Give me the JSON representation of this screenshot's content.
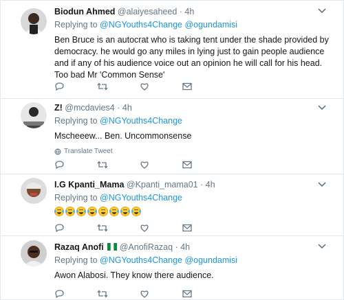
{
  "replying_prefix": "Replying to",
  "translate_label": "Translate Tweet",
  "colors": {
    "link": "#1b95e0",
    "muted": "#657786",
    "text": "#14171a",
    "border": "#e1e8ed"
  },
  "tweets": [
    {
      "name": "Biodun Ahmed",
      "handle": "@alaiyesaheed",
      "dot": "·",
      "time": "4h",
      "mentions": [
        "@NGYouths4Change",
        "@ogundamisi"
      ],
      "text": "Ben Bruce is an autocrat who is taking tent under the shade provided by democracy. he would go any miles in lying just to gain people audience and if any of his audience voice out an opinion he will call for his head. Too bad Mr 'Common Sense'",
      "icons": [
        "reply-icon",
        "retweet-icon",
        "like-icon",
        "message-icon"
      ]
    },
    {
      "name": "Z!",
      "handle": "@mcdavies4",
      "dot": "·",
      "time": "4h",
      "mentions": [
        "@NGYouths4Change"
      ],
      "text": "Mscheeew... Ben. Uncommonsense",
      "icons": [
        "reply-icon",
        "retweet-icon",
        "like-icon",
        "message-icon"
      ]
    },
    {
      "name": "I.G Kpanti_Mama",
      "handle": "@Kpanti_mama01",
      "dot": "·",
      "time": "4h",
      "mentions": [
        "@NGYouths4Change"
      ],
      "emojis": [
        "joy",
        "joy",
        "joy",
        "joy",
        "smile",
        "joy",
        "joy",
        "joy"
      ],
      "icons": [
        "reply-icon",
        "retweet-icon",
        "like-icon",
        "message-icon"
      ]
    },
    {
      "name": "Razaq Anofi",
      "handle": "@AnofiRazaq",
      "dot": "·",
      "time": "4h",
      "mentions": [
        "@NGYouths4Change",
        "@ogundamisi"
      ],
      "text": "Awon Alabosi. They know there audience.",
      "icons": [
        "reply-icon",
        "retweet-icon",
        "like-icon",
        "message-icon"
      ]
    }
  ]
}
